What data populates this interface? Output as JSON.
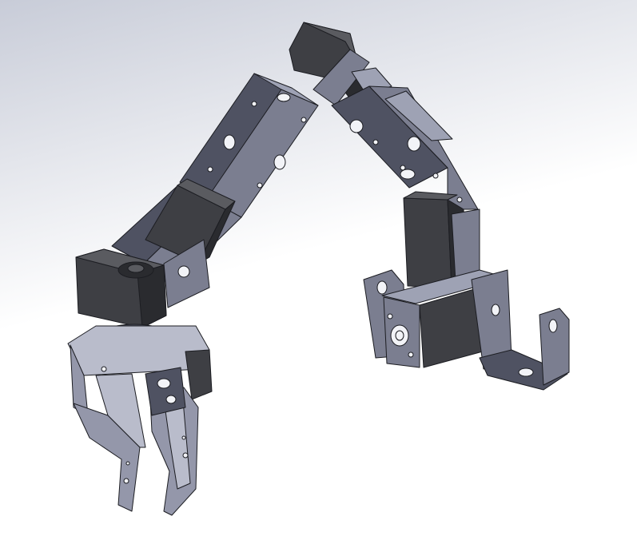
{
  "viewport": {
    "background_top": "#c8ccd8",
    "background_bottom": "#ffffff"
  },
  "model": {
    "subject": "robotic-arm-assembly",
    "parts": [
      "servo-bracket",
      "servo-motor",
      "gripper",
      "base-bracket"
    ],
    "colors": {
      "bracket": "#7b7e90",
      "bracket_dark": "#4f5262",
      "bracket_light": "#9ea2b4",
      "servo": "#3e3f44",
      "servo_dark": "#2a2b2f",
      "servo_light": "#5a5b60",
      "edge": "#1c1d22",
      "gripper": "#9497aa",
      "gripper_light": "#b9bccb"
    }
  }
}
